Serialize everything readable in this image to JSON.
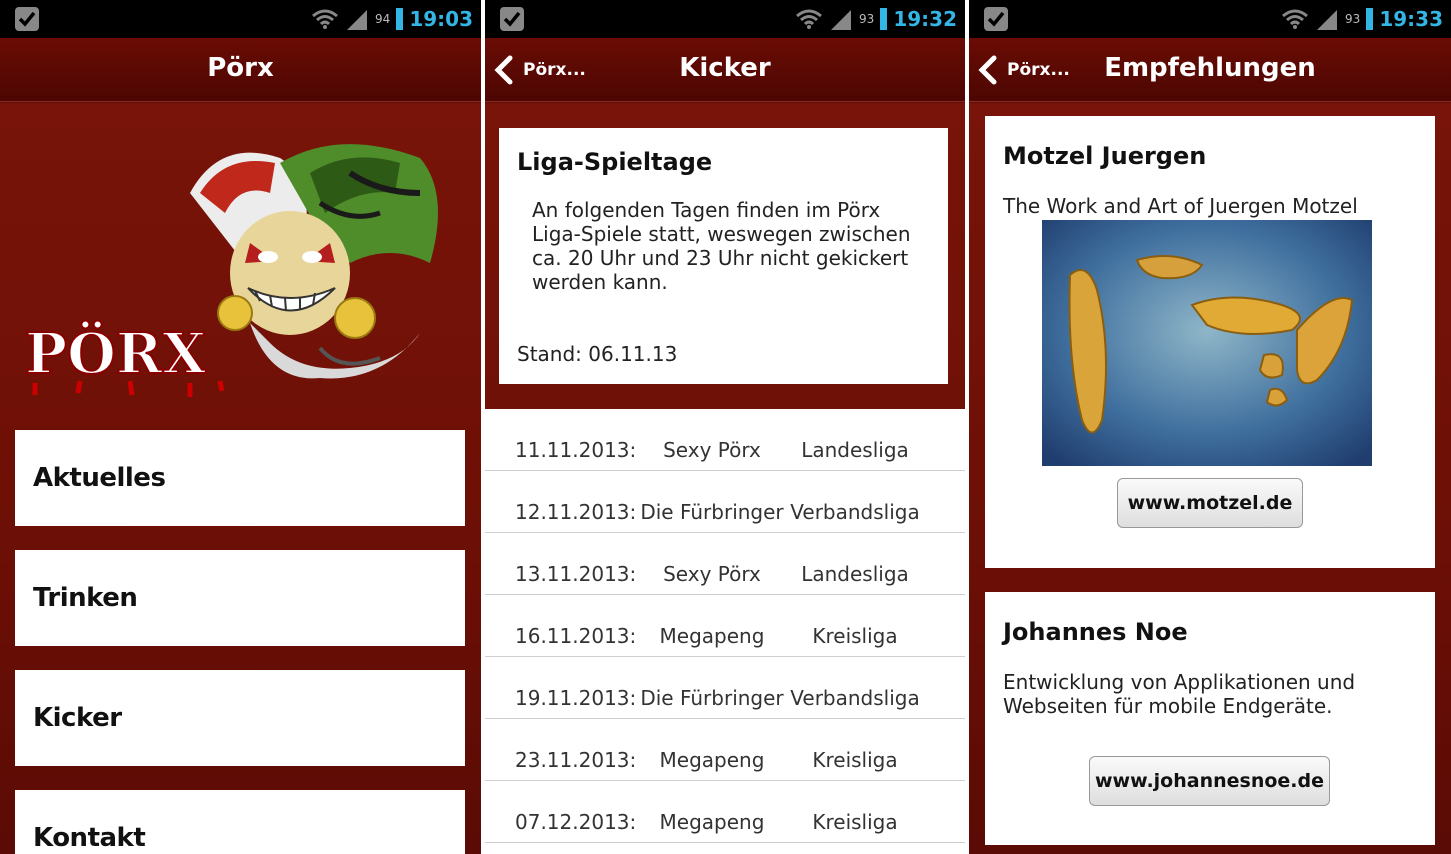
{
  "status_bars": [
    {
      "battery": "94",
      "time": "19:03"
    },
    {
      "battery": "93",
      "time": "19:32"
    },
    {
      "battery": "93",
      "time": "19:33"
    }
  ],
  "screen1": {
    "title": "Pörx",
    "logo_text": "PÖRX",
    "menu": [
      {
        "label": "Aktuelles"
      },
      {
        "label": "Trinken"
      },
      {
        "label": "Kicker"
      },
      {
        "label": "Kontakt"
      }
    ]
  },
  "screen2": {
    "back_label": "Pörx...",
    "title": "Kicker",
    "card": {
      "title": "Liga-Spieltage",
      "text": "An folgenden Tagen finden im Pörx Liga-Spiele statt, weswegen zwischen ca. 20 Uhr und 23 Uhr nicht gekickert werden kann.",
      "stand": "Stand: 06.11.13"
    },
    "schedule": [
      {
        "date": "11.11.2013:",
        "team": "Sexy Pörx",
        "league": "Landesliga"
      },
      {
        "date": "12.11.2013:",
        "team": "Die Fürbringer",
        "league": "Verbandsliga"
      },
      {
        "date": "13.11.2013:",
        "team": "Sexy Pörx",
        "league": "Landesliga"
      },
      {
        "date": "16.11.2013:",
        "team": "Megapeng",
        "league": "Kreisliga"
      },
      {
        "date": "19.11.2013:",
        "team": "Die Fürbringer",
        "league": "Verbandsliga"
      },
      {
        "date": "23.11.2013:",
        "team": "Megapeng",
        "league": "Kreisliga"
      },
      {
        "date": "07.12.2013:",
        "team": "Megapeng",
        "league": "Kreisliga"
      }
    ]
  },
  "screen3": {
    "back_label": "Pörx...",
    "title": "Empfehlungen",
    "recommendations": [
      {
        "name": "Motzel Juergen",
        "text": "The Work and Art of Juergen Motzel",
        "link": "www.motzel.de"
      },
      {
        "name": "Johannes Noe",
        "text": "Entwicklung von Applikationen und Webseiten für mobile Endgeräte.",
        "link": "www.johannesnoe.de"
      }
    ]
  },
  "colors": {
    "accent": "#33b5e5",
    "header": "#5a0a04",
    "background": "#6e1007"
  }
}
